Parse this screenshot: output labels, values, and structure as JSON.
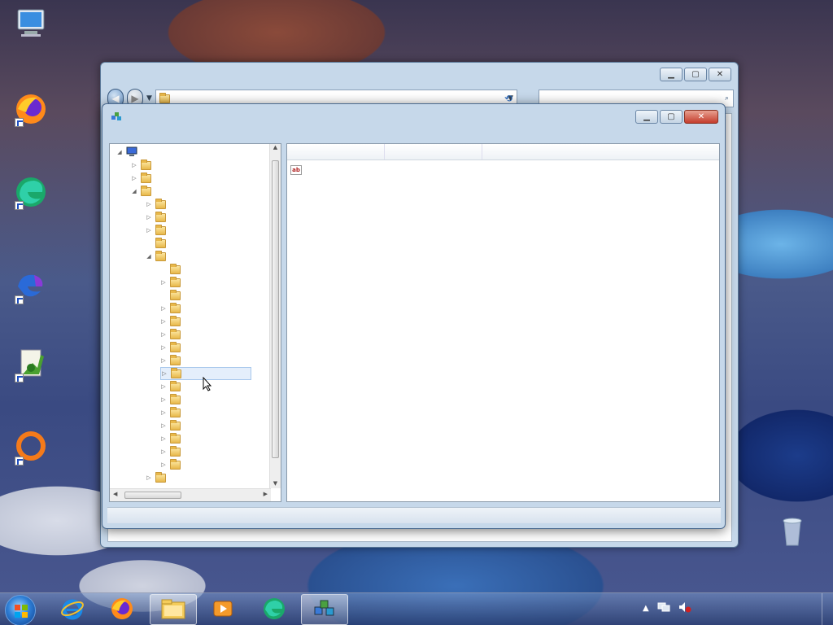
{
  "desktop_icons": [
    {
      "name": "computer-icon",
      "label": ""
    },
    {
      "name": "firefox-icon",
      "label": ""
    },
    {
      "name": "edge-icon",
      "label": ""
    },
    {
      "name": "edge-beta-icon",
      "label": ""
    },
    {
      "name": "notepad-icon",
      "label": ""
    },
    {
      "name": "origin-icon",
      "label": ""
    },
    {
      "name": "recycle-bin-icon",
      "label": ""
    }
  ],
  "explorer": {
    "address": "",
    "search_placeholder": ""
  },
  "regedit": {
    "title": "",
    "menu": [
      "",
      "",
      "",
      "",
      ""
    ],
    "tree": {
      "root": "",
      "items": [
        "",
        "",
        "",
        "",
        "",
        "",
        "",
        "",
        "",
        "",
        "",
        "",
        "",
        "",
        "",
        "",
        "",
        "",
        "",
        "",
        "",
        "",
        "",
        "",
        ""
      ]
    },
    "columns": [
      "",
      "",
      ""
    ],
    "rows": [
      {
        "name": "",
        "type": "",
        "data": ""
      }
    ],
    "status": ""
  },
  "taskbar": {
    "apps": [
      "ie-icon",
      "firefox-icon",
      "explorer-icon",
      "media-player-icon",
      "edge-icon",
      "regedit-icon"
    ],
    "time": "",
    "date": ""
  }
}
